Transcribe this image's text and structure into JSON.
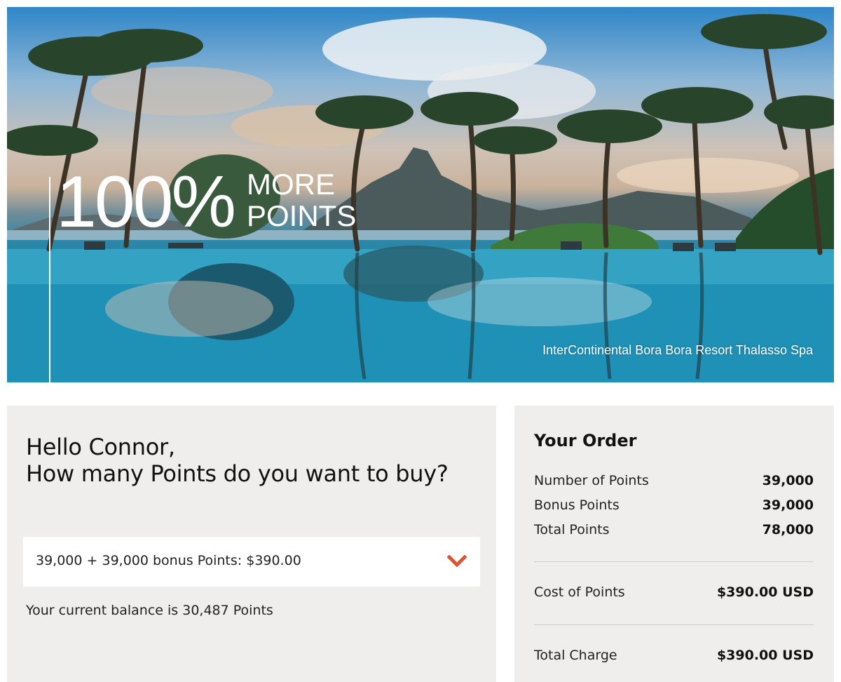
{
  "hero": {
    "percent": "100%",
    "more_label": "MORE",
    "points_label": "POINTS",
    "caption": "InterContinental Bora Bora Resort Thalasso Spa"
  },
  "purchase": {
    "greeting_line1": "Hello Connor,",
    "greeting_line2": "How many Points do you want to buy?",
    "selected_option": "39,000 + 39,000 bonus Points: $390.00",
    "dropdown_icon": "chevron-down-icon",
    "balance_text": "Your current balance is 30,487 Points"
  },
  "order": {
    "title": "Your Order",
    "rows": [
      {
        "label": "Number of Points",
        "value": "39,000"
      },
      {
        "label": "Bonus Points",
        "value": "39,000"
      },
      {
        "label": "Total Points",
        "value": "78,000"
      }
    ],
    "cost_label": "Cost of Points",
    "cost_value": "$390.00 USD",
    "total_label": "Total Charge",
    "total_value": "$390.00 USD"
  },
  "colors": {
    "panel_background": "#efeeec",
    "accent_chevron": "#e0522f",
    "text_primary": "#111111"
  }
}
